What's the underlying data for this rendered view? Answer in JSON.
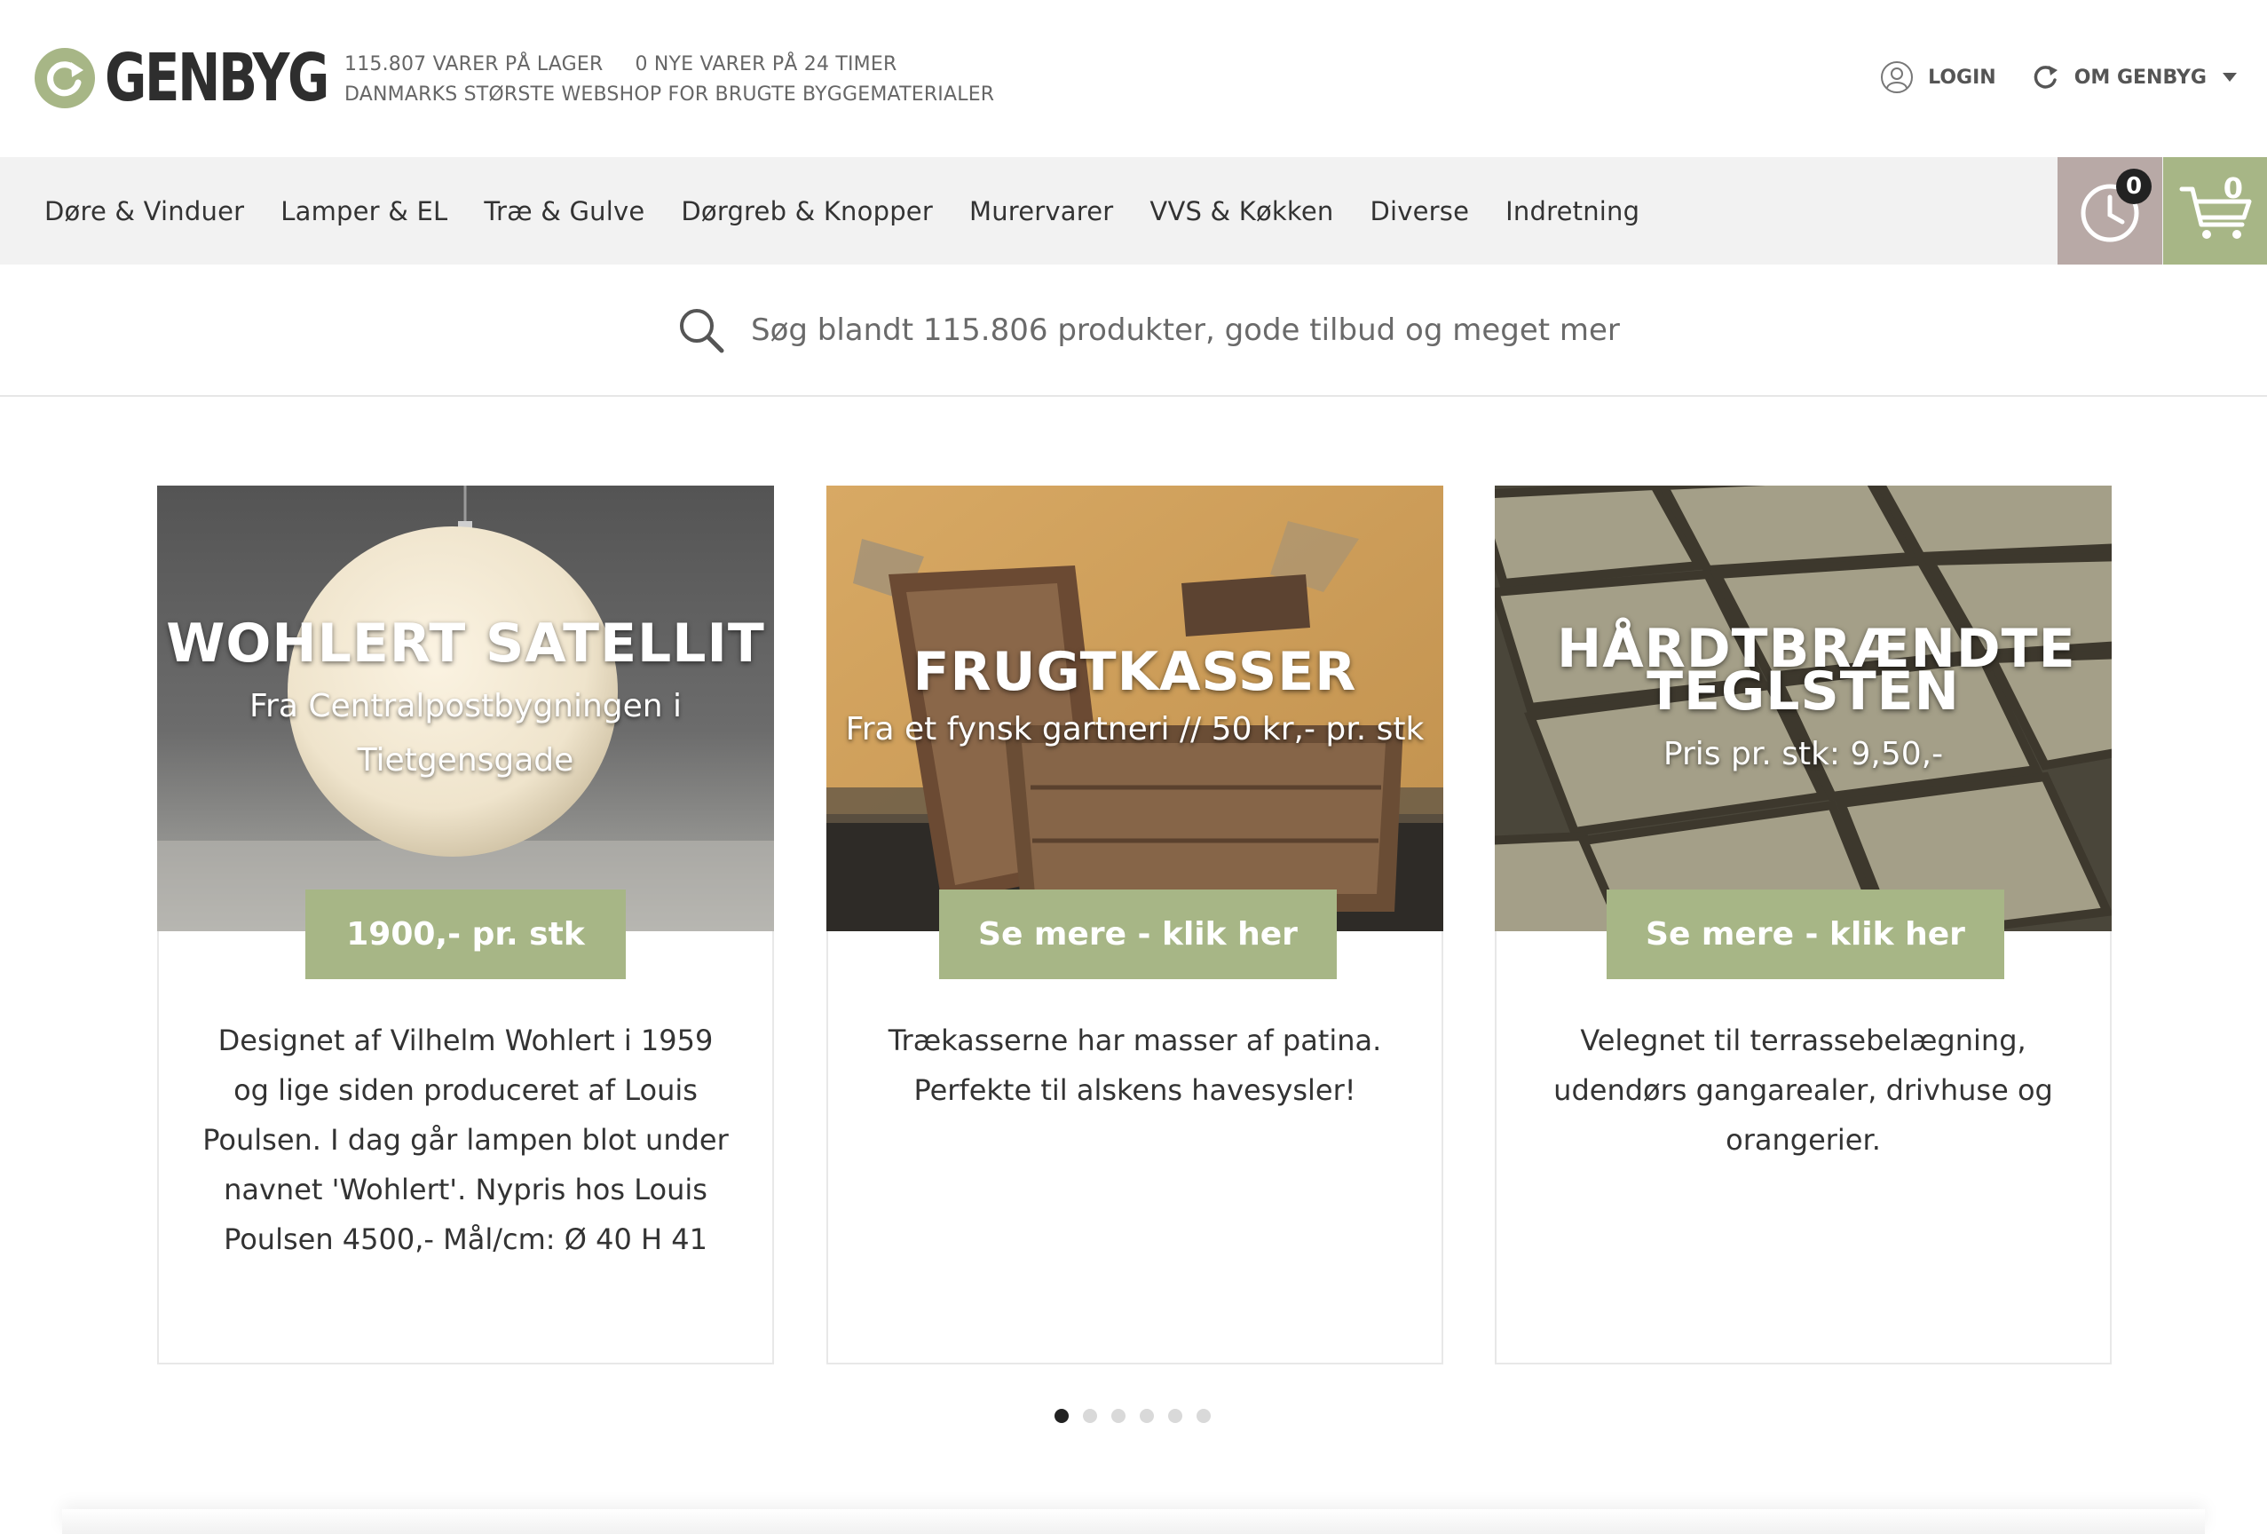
{
  "header": {
    "logo_text": "GENBYG",
    "stock_count": "115.807 VARER PÅ LAGER",
    "new_items": "0 NYE VARER PÅ 24 TIMER",
    "tagline": "DANMARKS STØRSTE WEBSHOP FOR BRUGTE BYGGEMATERIALER",
    "login_label": "LOGIN",
    "about_label": "OM GENBYG"
  },
  "nav": {
    "items": [
      {
        "label": "Døre & Vinduer"
      },
      {
        "label": "Lamper & EL"
      },
      {
        "label": "Træ & Gulve"
      },
      {
        "label": "Dørgreb & Knopper"
      },
      {
        "label": "Murervarer"
      },
      {
        "label": "VVS & Køkken"
      },
      {
        "label": "Diverse"
      },
      {
        "label": "Indretning"
      }
    ],
    "history_count": "0",
    "cart_count": "0"
  },
  "search": {
    "placeholder": "Søg blandt 115.806 produkter, gode tilbud og meget mere..."
  },
  "cards": [
    {
      "title": "WOHLERT SATELLIT",
      "subtitle": "Fra Centralpostbygningen i Tietgensgade",
      "cta": "1900,- pr. stk",
      "description": "Designet af Vilhelm Wohlert i 1959 og lige siden produceret af Louis Poulsen. I dag går lampen blot under navnet 'Wohlert'. Nypris hos Louis Poulsen 4500,- Mål/cm: Ø 40 H 41"
    },
    {
      "title": "FRUGTKASSER",
      "subtitle": "Fra et fynsk gartneri // 50 kr,- pr. stk",
      "cta": "Se mere - klik her",
      "description": "Trækasserne har masser af patina. Perfekte til alskens havesysler!"
    },
    {
      "title": "HÅRDTBRÆNDTE TEGLSTEN",
      "subtitle": "Pris pr. stk: 9,50,-",
      "cta": "Se mere - klik her",
      "description": "Velegnet til terrassebelægning, udendørs gangarealer, drivhuse og orangerier."
    }
  ],
  "carousel": {
    "pages": 6,
    "active": 1
  },
  "colors": {
    "accent_green": "#a7b686",
    "history_button": "#b8a9a6",
    "nav_background": "#f2f2f2",
    "text_dark": "#333333"
  }
}
